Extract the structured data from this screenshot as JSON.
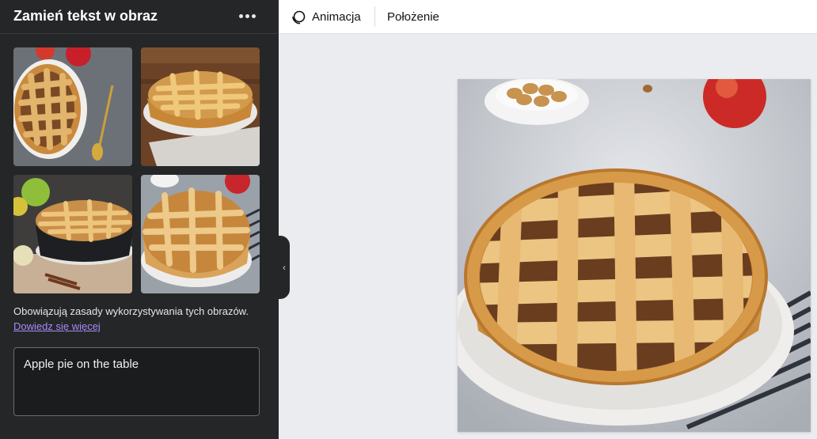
{
  "panel": {
    "title": "Zamień tekst w obraz",
    "more_icon": "more-horizontal-icon",
    "terms_text": "Obowiązują zasady wykorzystywania tych obrazów.",
    "learn_more": "Dowiedz się więcej",
    "prompt_value": "Apple pie on the table",
    "collapse_icon": "chevron-left-icon"
  },
  "toolbar": {
    "animation_label": "Animacja",
    "animation_icon": "animation-icon",
    "position_label": "Położenie"
  },
  "colors": {
    "panel_bg": "#252627",
    "link": "#a78bfa",
    "canvas_bg": "#ebecf0"
  }
}
